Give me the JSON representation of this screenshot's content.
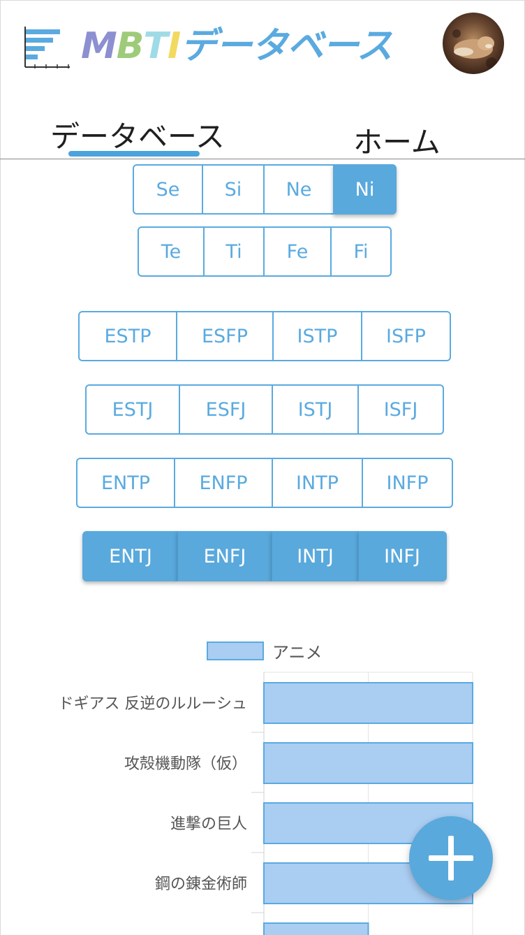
{
  "header": {
    "title_letters": [
      "M",
      "B",
      "T",
      "I"
    ],
    "title_rest": "データベース",
    "avatar_label": "user avatar"
  },
  "tabs": [
    {
      "label": "データベース",
      "active": true
    },
    {
      "label": "ホーム",
      "active": false
    }
  ],
  "functions": {
    "row1": [
      {
        "label": "Se",
        "active": false
      },
      {
        "label": "Si",
        "active": false
      },
      {
        "label": "Ne",
        "active": false
      },
      {
        "label": "Ni",
        "active": true
      }
    ],
    "row2": [
      {
        "label": "Te",
        "active": false
      },
      {
        "label": "Ti",
        "active": false
      },
      {
        "label": "Fe",
        "active": false
      },
      {
        "label": "Fi",
        "active": false
      }
    ]
  },
  "types": {
    "row1": [
      {
        "label": "ESTP",
        "active": false
      },
      {
        "label": "ESFP",
        "active": false
      },
      {
        "label": "ISTP",
        "active": false
      },
      {
        "label": "ISFP",
        "active": false
      }
    ],
    "row2": [
      {
        "label": "ESTJ",
        "active": false
      },
      {
        "label": "ESFJ",
        "active": false
      },
      {
        "label": "ISTJ",
        "active": false
      },
      {
        "label": "ISFJ",
        "active": false
      }
    ],
    "row3": [
      {
        "label": "ENTP",
        "active": false
      },
      {
        "label": "ENFP",
        "active": false
      },
      {
        "label": "INTP",
        "active": false
      },
      {
        "label": "INFP",
        "active": false
      }
    ],
    "row4": [
      {
        "label": "ENTJ",
        "active": true
      },
      {
        "label": "ENFJ",
        "active": true
      },
      {
        "label": "INTJ",
        "active": true
      },
      {
        "label": "INFJ",
        "active": true
      }
    ]
  },
  "colors": {
    "accent": "#59a9dc",
    "bar_fill": "#aacdf2",
    "bar_stroke": "#5aaae0"
  },
  "chart_data": {
    "type": "bar",
    "orientation": "horizontal",
    "categories": [
      "ドギアス 反逆のルルーシュ",
      "攻殻機動隊（仮）",
      "進撃の巨人",
      "鋼の錬金術師",
      ""
    ],
    "series": [
      {
        "name": "アニメ",
        "values": [
          2,
          2,
          2,
          2,
          1
        ]
      }
    ],
    "xlim": [
      0,
      2
    ],
    "grid": true,
    "legend_position": "top"
  },
  "fab": {
    "icon": "plus-icon"
  }
}
